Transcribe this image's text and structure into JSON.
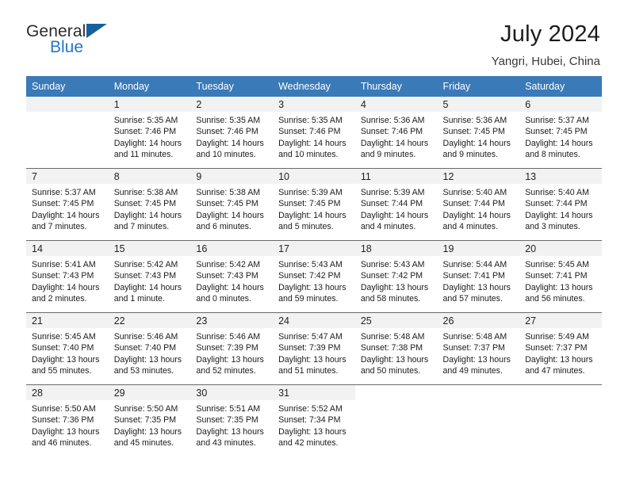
{
  "brand": {
    "name_top": "General",
    "name_bottom": "Blue"
  },
  "header": {
    "title": "July 2024",
    "location": "Yangri, Hubei, China"
  },
  "colors": {
    "header_blue": "#3a7ab8",
    "brand_blue": "#2277c8",
    "triangle_blue": "#15619e",
    "day_strip": "#f2f2f2",
    "grid_line": "#6a6a6a"
  },
  "weekdays": [
    "Sunday",
    "Monday",
    "Tuesday",
    "Wednesday",
    "Thursday",
    "Friday",
    "Saturday"
  ],
  "weeks": [
    [
      {
        "day": "",
        "sunrise": "",
        "sunset": "",
        "daylight1": "",
        "daylight2": "",
        "empty": true
      },
      {
        "day": "1",
        "sunrise": "Sunrise: 5:35 AM",
        "sunset": "Sunset: 7:46 PM",
        "daylight1": "Daylight: 14 hours",
        "daylight2": "and 11 minutes."
      },
      {
        "day": "2",
        "sunrise": "Sunrise: 5:35 AM",
        "sunset": "Sunset: 7:46 PM",
        "daylight1": "Daylight: 14 hours",
        "daylight2": "and 10 minutes."
      },
      {
        "day": "3",
        "sunrise": "Sunrise: 5:35 AM",
        "sunset": "Sunset: 7:46 PM",
        "daylight1": "Daylight: 14 hours",
        "daylight2": "and 10 minutes."
      },
      {
        "day": "4",
        "sunrise": "Sunrise: 5:36 AM",
        "sunset": "Sunset: 7:46 PM",
        "daylight1": "Daylight: 14 hours",
        "daylight2": "and 9 minutes."
      },
      {
        "day": "5",
        "sunrise": "Sunrise: 5:36 AM",
        "sunset": "Sunset: 7:45 PM",
        "daylight1": "Daylight: 14 hours",
        "daylight2": "and 9 minutes."
      },
      {
        "day": "6",
        "sunrise": "Sunrise: 5:37 AM",
        "sunset": "Sunset: 7:45 PM",
        "daylight1": "Daylight: 14 hours",
        "daylight2": "and 8 minutes."
      }
    ],
    [
      {
        "day": "7",
        "sunrise": "Sunrise: 5:37 AM",
        "sunset": "Sunset: 7:45 PM",
        "daylight1": "Daylight: 14 hours",
        "daylight2": "and 7 minutes."
      },
      {
        "day": "8",
        "sunrise": "Sunrise: 5:38 AM",
        "sunset": "Sunset: 7:45 PM",
        "daylight1": "Daylight: 14 hours",
        "daylight2": "and 7 minutes."
      },
      {
        "day": "9",
        "sunrise": "Sunrise: 5:38 AM",
        "sunset": "Sunset: 7:45 PM",
        "daylight1": "Daylight: 14 hours",
        "daylight2": "and 6 minutes."
      },
      {
        "day": "10",
        "sunrise": "Sunrise: 5:39 AM",
        "sunset": "Sunset: 7:45 PM",
        "daylight1": "Daylight: 14 hours",
        "daylight2": "and 5 minutes."
      },
      {
        "day": "11",
        "sunrise": "Sunrise: 5:39 AM",
        "sunset": "Sunset: 7:44 PM",
        "daylight1": "Daylight: 14 hours",
        "daylight2": "and 4 minutes."
      },
      {
        "day": "12",
        "sunrise": "Sunrise: 5:40 AM",
        "sunset": "Sunset: 7:44 PM",
        "daylight1": "Daylight: 14 hours",
        "daylight2": "and 4 minutes."
      },
      {
        "day": "13",
        "sunrise": "Sunrise: 5:40 AM",
        "sunset": "Sunset: 7:44 PM",
        "daylight1": "Daylight: 14 hours",
        "daylight2": "and 3 minutes."
      }
    ],
    [
      {
        "day": "14",
        "sunrise": "Sunrise: 5:41 AM",
        "sunset": "Sunset: 7:43 PM",
        "daylight1": "Daylight: 14 hours",
        "daylight2": "and 2 minutes."
      },
      {
        "day": "15",
        "sunrise": "Sunrise: 5:42 AM",
        "sunset": "Sunset: 7:43 PM",
        "daylight1": "Daylight: 14 hours",
        "daylight2": "and 1 minute."
      },
      {
        "day": "16",
        "sunrise": "Sunrise: 5:42 AM",
        "sunset": "Sunset: 7:43 PM",
        "daylight1": "Daylight: 14 hours",
        "daylight2": "and 0 minutes."
      },
      {
        "day": "17",
        "sunrise": "Sunrise: 5:43 AM",
        "sunset": "Sunset: 7:42 PM",
        "daylight1": "Daylight: 13 hours",
        "daylight2": "and 59 minutes."
      },
      {
        "day": "18",
        "sunrise": "Sunrise: 5:43 AM",
        "sunset": "Sunset: 7:42 PM",
        "daylight1": "Daylight: 13 hours",
        "daylight2": "and 58 minutes."
      },
      {
        "day": "19",
        "sunrise": "Sunrise: 5:44 AM",
        "sunset": "Sunset: 7:41 PM",
        "daylight1": "Daylight: 13 hours",
        "daylight2": "and 57 minutes."
      },
      {
        "day": "20",
        "sunrise": "Sunrise: 5:45 AM",
        "sunset": "Sunset: 7:41 PM",
        "daylight1": "Daylight: 13 hours",
        "daylight2": "and 56 minutes."
      }
    ],
    [
      {
        "day": "21",
        "sunrise": "Sunrise: 5:45 AM",
        "sunset": "Sunset: 7:40 PM",
        "daylight1": "Daylight: 13 hours",
        "daylight2": "and 55 minutes."
      },
      {
        "day": "22",
        "sunrise": "Sunrise: 5:46 AM",
        "sunset": "Sunset: 7:40 PM",
        "daylight1": "Daylight: 13 hours",
        "daylight2": "and 53 minutes."
      },
      {
        "day": "23",
        "sunrise": "Sunrise: 5:46 AM",
        "sunset": "Sunset: 7:39 PM",
        "daylight1": "Daylight: 13 hours",
        "daylight2": "and 52 minutes."
      },
      {
        "day": "24",
        "sunrise": "Sunrise: 5:47 AM",
        "sunset": "Sunset: 7:39 PM",
        "daylight1": "Daylight: 13 hours",
        "daylight2": "and 51 minutes."
      },
      {
        "day": "25",
        "sunrise": "Sunrise: 5:48 AM",
        "sunset": "Sunset: 7:38 PM",
        "daylight1": "Daylight: 13 hours",
        "daylight2": "and 50 minutes."
      },
      {
        "day": "26",
        "sunrise": "Sunrise: 5:48 AM",
        "sunset": "Sunset: 7:37 PM",
        "daylight1": "Daylight: 13 hours",
        "daylight2": "and 49 minutes."
      },
      {
        "day": "27",
        "sunrise": "Sunrise: 5:49 AM",
        "sunset": "Sunset: 7:37 PM",
        "daylight1": "Daylight: 13 hours",
        "daylight2": "and 47 minutes."
      }
    ],
    [
      {
        "day": "28",
        "sunrise": "Sunrise: 5:50 AM",
        "sunset": "Sunset: 7:36 PM",
        "daylight1": "Daylight: 13 hours",
        "daylight2": "and 46 minutes."
      },
      {
        "day": "29",
        "sunrise": "Sunrise: 5:50 AM",
        "sunset": "Sunset: 7:35 PM",
        "daylight1": "Daylight: 13 hours",
        "daylight2": "and 45 minutes."
      },
      {
        "day": "30",
        "sunrise": "Sunrise: 5:51 AM",
        "sunset": "Sunset: 7:35 PM",
        "daylight1": "Daylight: 13 hours",
        "daylight2": "and 43 minutes."
      },
      {
        "day": "31",
        "sunrise": "Sunrise: 5:52 AM",
        "sunset": "Sunset: 7:34 PM",
        "daylight1": "Daylight: 13 hours",
        "daylight2": "and 42 minutes."
      },
      {
        "day": "",
        "sunrise": "",
        "sunset": "",
        "daylight1": "",
        "daylight2": "",
        "empty": true,
        "blank": true
      },
      {
        "day": "",
        "sunrise": "",
        "sunset": "",
        "daylight1": "",
        "daylight2": "",
        "empty": true,
        "blank": true
      },
      {
        "day": "",
        "sunrise": "",
        "sunset": "",
        "daylight1": "",
        "daylight2": "",
        "empty": true,
        "blank": true
      }
    ]
  ]
}
